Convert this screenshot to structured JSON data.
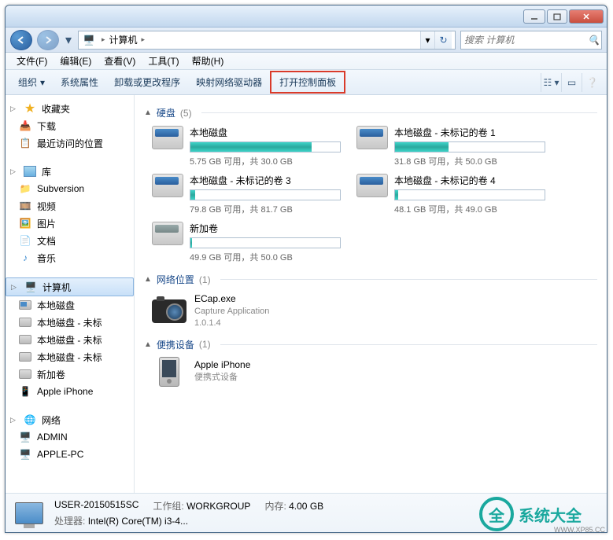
{
  "breadcrumb": {
    "root_icon": "computer",
    "items": [
      "计算机"
    ],
    "arrow": "▸"
  },
  "search": {
    "placeholder": "搜索 计算机"
  },
  "menubar": [
    "文件(F)",
    "编辑(E)",
    "查看(V)",
    "工具(T)",
    "帮助(H)"
  ],
  "toolbar": {
    "organize": "组织",
    "items": [
      "系统属性",
      "卸载或更改程序",
      "映射网络驱动器",
      "打开控制面板"
    ],
    "highlight_index": 3
  },
  "sidebar": {
    "favorites": {
      "label": "收藏夹",
      "items": [
        "下载",
        "最近访问的位置"
      ]
    },
    "libraries": {
      "label": "库",
      "items": [
        "Subversion",
        "视频",
        "图片",
        "文档",
        "音乐"
      ]
    },
    "computer": {
      "label": "计算机",
      "items": [
        "本地磁盘",
        "本地磁盘 - 未标",
        "本地磁盘 - 未标",
        "本地磁盘 - 未标",
        "新加卷",
        "Apple iPhone"
      ]
    },
    "network": {
      "label": "网络",
      "items": [
        "ADMIN",
        "APPLE-PC"
      ]
    }
  },
  "groups": {
    "drives": {
      "title": "硬盘",
      "count": "(5)",
      "items": [
        {
          "name": "本地磁盘",
          "free": "5.75 GB 可用，共 30.0 GB",
          "pct": 81
        },
        {
          "name": "本地磁盘 - 未标记的卷 1",
          "free": "31.8 GB 可用，共 50.0 GB",
          "pct": 36
        },
        {
          "name": "本地磁盘 - 未标记的卷 3",
          "free": "79.8 GB 可用，共 81.7 GB",
          "pct": 3
        },
        {
          "name": "本地磁盘 - 未标记的卷 4",
          "free": "48.1 GB 可用，共 49.0 GB",
          "pct": 2
        },
        {
          "name": "新加卷",
          "free": "49.9 GB 可用，共 50.0 GB",
          "pct": 1,
          "newvol": true
        }
      ]
    },
    "network": {
      "title": "网络位置",
      "count": "(1)",
      "item": {
        "name": "ECap.exe",
        "line2": "Capture Application",
        "line3": "1.0.1.4"
      }
    },
    "portable": {
      "title": "便携设备",
      "count": "(1)",
      "item": {
        "name": "Apple iPhone",
        "line2": "便携式设备"
      }
    }
  },
  "status": {
    "computer_name": "USER-20150515SC",
    "workgroup_label": "工作组:",
    "workgroup": "WORKGROUP",
    "mem_label": "内存:",
    "mem": "4.00 GB",
    "cpu_label": "处理器:",
    "cpu": "Intel(R) Core(TM) i3-4..."
  },
  "watermark": {
    "text": "系统大全",
    "url": "WWW.XP85.CC"
  }
}
